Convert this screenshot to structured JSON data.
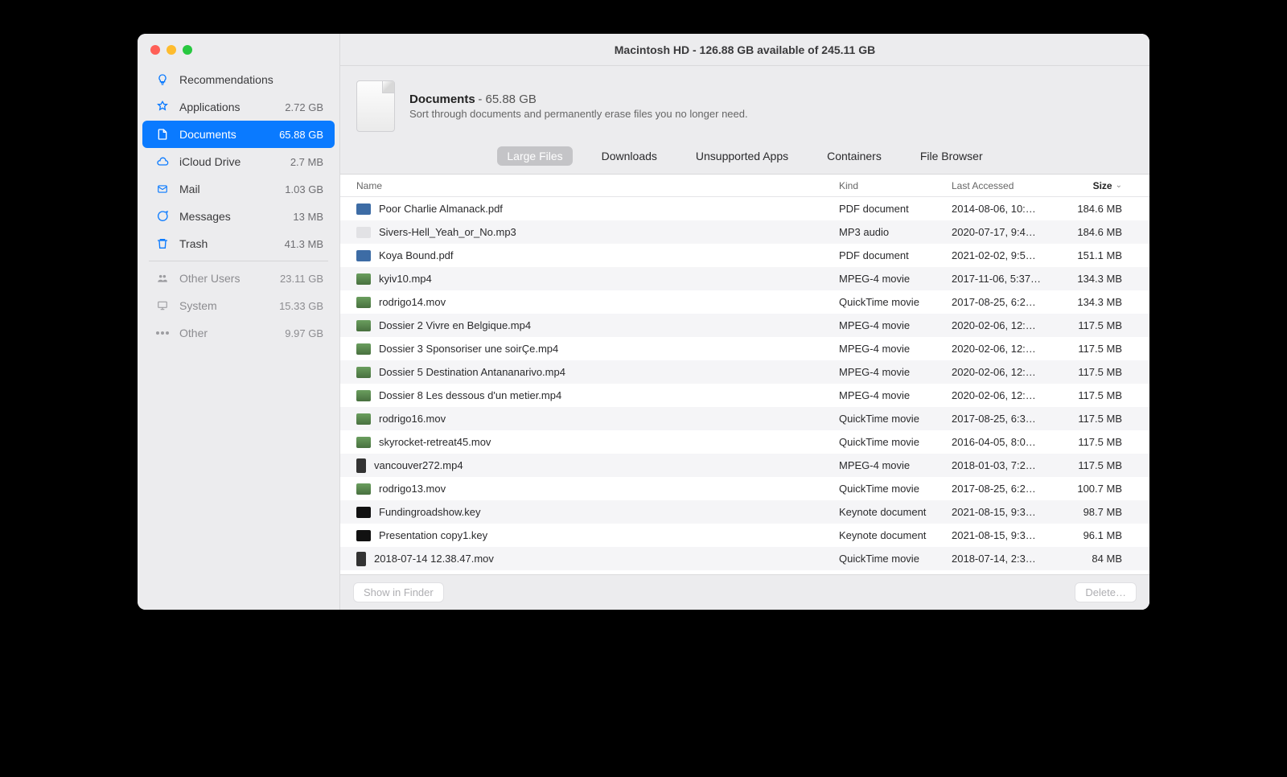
{
  "window": {
    "title": "Macintosh HD - 126.88 GB available of 245.11 GB"
  },
  "sidebar": {
    "items": [
      {
        "icon": "bulb",
        "label": "Recommendations",
        "size": "",
        "selected": false,
        "dim": false
      },
      {
        "icon": "app",
        "label": "Applications",
        "size": "2.72 GB",
        "selected": false,
        "dim": false
      },
      {
        "icon": "doc",
        "label": "Documents",
        "size": "65.88 GB",
        "selected": true,
        "dim": false
      },
      {
        "icon": "cloud",
        "label": "iCloud Drive",
        "size": "2.7 MB",
        "selected": false,
        "dim": false
      },
      {
        "icon": "mail",
        "label": "Mail",
        "size": "1.03 GB",
        "selected": false,
        "dim": false
      },
      {
        "icon": "msg",
        "label": "Messages",
        "size": "13 MB",
        "selected": false,
        "dim": false
      },
      {
        "icon": "trash",
        "label": "Trash",
        "size": "41.3 MB",
        "selected": false,
        "dim": false
      }
    ],
    "items2": [
      {
        "icon": "users",
        "label": "Other Users",
        "size": "23.11 GB",
        "selected": false,
        "dim": true
      },
      {
        "icon": "system",
        "label": "System",
        "size": "15.33 GB",
        "selected": false,
        "dim": true
      },
      {
        "icon": "dots",
        "label": "Other",
        "size": "9.97 GB",
        "selected": false,
        "dim": true
      }
    ]
  },
  "header": {
    "title": "Documents",
    "size": "65.88 GB",
    "subtitle": "Sort through documents and permanently erase files you no longer need."
  },
  "tabs": [
    {
      "label": "Large Files",
      "active": true
    },
    {
      "label": "Downloads",
      "active": false
    },
    {
      "label": "Unsupported Apps",
      "active": false
    },
    {
      "label": "Containers",
      "active": false
    },
    {
      "label": "File Browser",
      "active": false
    }
  ],
  "columns": {
    "name": "Name",
    "kind": "Kind",
    "date": "Last Accessed",
    "size": "Size"
  },
  "files": [
    {
      "thumb": "pdf",
      "name": "Poor Charlie Almanack.pdf",
      "kind": "PDF document",
      "date": "2014-08-06, 10:…",
      "size": "184.6 MB"
    },
    {
      "thumb": "audio",
      "name": "Sivers-Hell_Yeah_or_No.mp3",
      "kind": "MP3 audio",
      "date": "2020-07-17, 9:4…",
      "size": "184.6 MB"
    },
    {
      "thumb": "pdf",
      "name": "Koya Bound.pdf",
      "kind": "PDF document",
      "date": "2021-02-02, 9:5…",
      "size": "151.1 MB"
    },
    {
      "thumb": "video",
      "name": "kyiv10.mp4",
      "kind": "MPEG-4 movie",
      "date": "2017-11-06, 5:37…",
      "size": "134.3 MB"
    },
    {
      "thumb": "video",
      "name": "rodrigo14.mov",
      "kind": "QuickTime movie",
      "date": "2017-08-25, 6:2…",
      "size": "134.3 MB"
    },
    {
      "thumb": "video",
      "name": "Dossier 2 Vivre en Belgique.mp4",
      "kind": "MPEG-4 movie",
      "date": "2020-02-06, 12:…",
      "size": "117.5 MB"
    },
    {
      "thumb": "video",
      "name": "Dossier 3 Sponsoriser une soirÇe.mp4",
      "kind": "MPEG-4 movie",
      "date": "2020-02-06, 12:…",
      "size": "117.5 MB"
    },
    {
      "thumb": "video",
      "name": "Dossier 5 Destination Antananarivo.mp4",
      "kind": "MPEG-4 movie",
      "date": "2020-02-06, 12:…",
      "size": "117.5 MB"
    },
    {
      "thumb": "video",
      "name": "Dossier 8 Les dessous d'un metier.mp4",
      "kind": "MPEG-4 movie",
      "date": "2020-02-06, 12:…",
      "size": "117.5 MB"
    },
    {
      "thumb": "video",
      "name": "rodrigo16.mov",
      "kind": "QuickTime movie",
      "date": "2017-08-25, 6:3…",
      "size": "117.5 MB"
    },
    {
      "thumb": "video",
      "name": "skyrocket-retreat45.mov",
      "kind": "QuickTime movie",
      "date": "2016-04-05, 8:0…",
      "size": "117.5 MB"
    },
    {
      "thumb": "phone",
      "name": "vancouver272.mp4",
      "kind": "MPEG-4 movie",
      "date": "2018-01-03, 7:2…",
      "size": "117.5 MB"
    },
    {
      "thumb": "video",
      "name": "rodrigo13.mov",
      "kind": "QuickTime movie",
      "date": "2017-08-25, 6:2…",
      "size": "100.7 MB"
    },
    {
      "thumb": "key",
      "name": "Fundingroadshow.key",
      "kind": "Keynote document",
      "date": "2021-08-15, 9:3…",
      "size": "98.7 MB"
    },
    {
      "thumb": "key",
      "name": "Presentation copy1.key",
      "kind": "Keynote document",
      "date": "2021-08-15, 9:3…",
      "size": "96.1 MB"
    },
    {
      "thumb": "phone",
      "name": "2018-07-14 12.38.47.mov",
      "kind": "QuickTime movie",
      "date": "2018-07-14, 2:3…",
      "size": "84 MB"
    }
  ],
  "footer": {
    "show": "Show in Finder",
    "delete": "Delete…"
  }
}
